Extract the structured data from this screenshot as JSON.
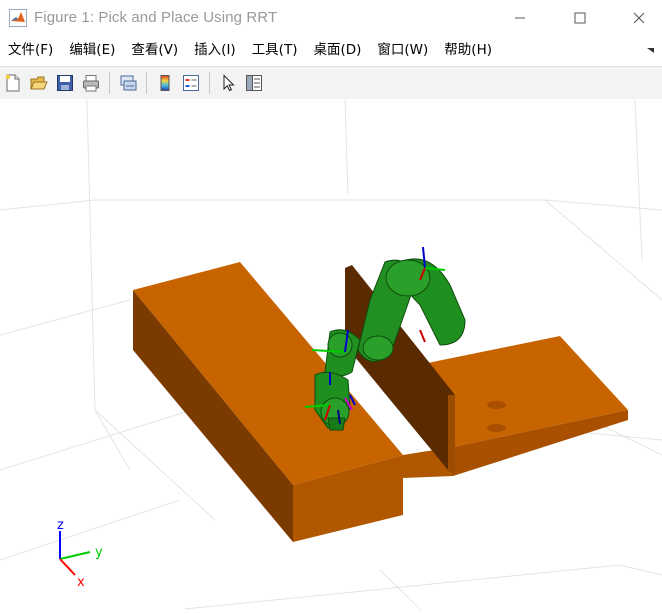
{
  "window": {
    "title": "Figure 1: Pick and Place Using RRT",
    "app_icon": "matlab-logo-icon",
    "controls": [
      "minimize-icon",
      "maximize-icon",
      "close-icon"
    ]
  },
  "menubar": {
    "items": [
      "文件(F)",
      "编辑(E)",
      "查看(V)",
      "插入(I)",
      "工具(T)",
      "桌面(D)",
      "窗口(W)",
      "帮助(H)"
    ]
  },
  "toolbar": {
    "buttons": [
      "new-figure-icon",
      "open-file-icon",
      "save-icon",
      "print-icon",
      "link-plot-icon",
      "insert-colorbar-icon",
      "insert-legend-icon",
      "pointer-icon",
      "property-editor-icon"
    ]
  },
  "axes_triad": {
    "z_label": "z",
    "y_label": "y",
    "x_label": "x",
    "colors": {
      "x": "#ff0000",
      "y": "#00cc00",
      "z": "#0000ff"
    }
  },
  "scene": {
    "table_color": "#c86400",
    "robot_color": "#1f8f1f"
  }
}
